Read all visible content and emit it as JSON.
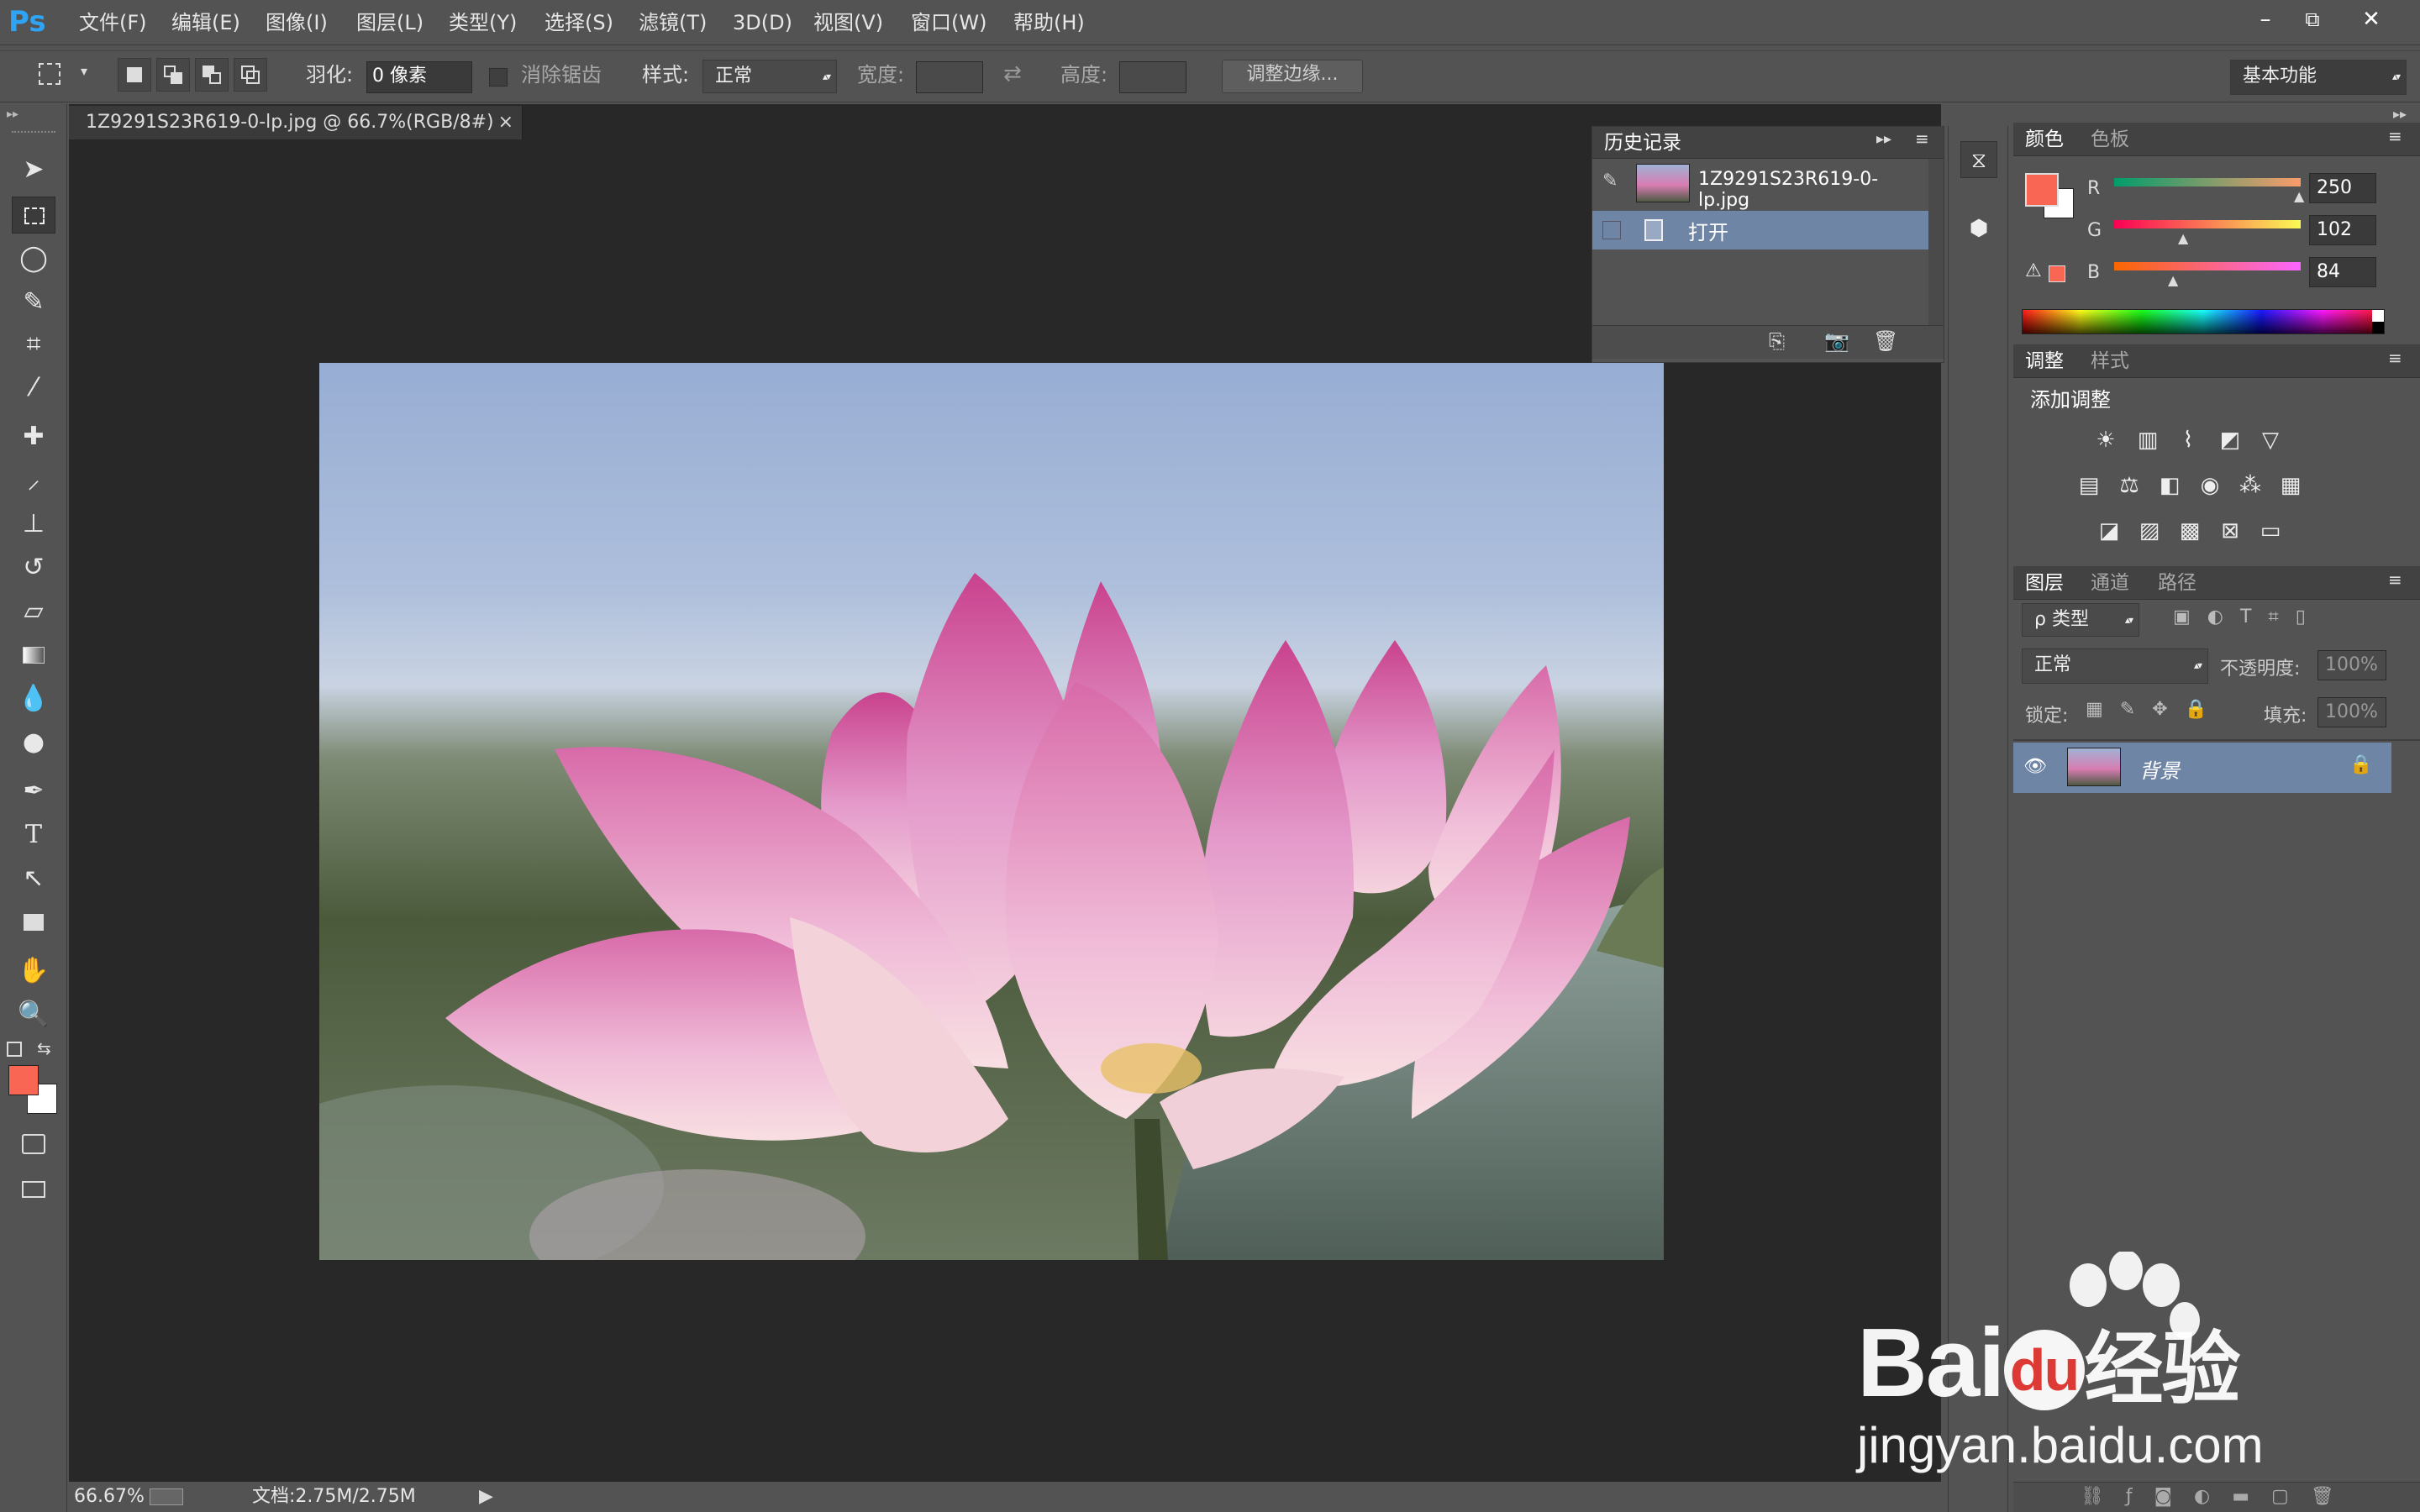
{
  "app": {
    "logo": "Ps"
  },
  "menu": {
    "items": [
      "文件(F)",
      "编辑(E)",
      "图像(I)",
      "图层(L)",
      "类型(Y)",
      "选择(S)",
      "滤镜(T)",
      "3D(D)",
      "视图(V)",
      "窗口(W)",
      "帮助(H)"
    ]
  },
  "window_controls": {
    "minimize": "–",
    "restore": "⧉",
    "close": "✕"
  },
  "options": {
    "feather_label": "羽化:",
    "feather_value": "0 像素",
    "antialias_label": "消除锯齿",
    "style_label": "样式:",
    "style_value": "正常",
    "width_label": "宽度:",
    "height_label": "高度:",
    "refine_edge": "调整边缘...",
    "workspace": "基本功能"
  },
  "document": {
    "tab_title": "1Z9291S23R619-0-lp.jpg @ 66.7%(RGB/8#)",
    "close": "×"
  },
  "status": {
    "zoom": "66.67%",
    "doc_size": "文档:2.75M/2.75M"
  },
  "history": {
    "tab": "历史记录",
    "snapshot_name": "1Z9291S23R619-0-lp.jpg",
    "steps": [
      "打开"
    ]
  },
  "color_panel": {
    "tabs": [
      "颜色",
      "色板"
    ],
    "r_label": "R",
    "g_label": "G",
    "b_label": "B",
    "r": "250",
    "g": "102",
    "b": "84",
    "foreground": "#FA6654",
    "background": "#FFFFFF"
  },
  "adjust_panel": {
    "tabs": [
      "调整",
      "样式"
    ],
    "heading": "添加调整"
  },
  "layers_panel": {
    "tabs": [
      "图层",
      "通道",
      "路径"
    ],
    "filter_kind": "ρ 类型",
    "blend_mode": "正常",
    "opacity_label": "不透明度:",
    "opacity_value": "100%",
    "lock_label": "锁定:",
    "fill_label": "填充:",
    "fill_value": "100%",
    "layer_name": "背景"
  },
  "watermark": {
    "brand_left": "Bai",
    "brand_mid": "du",
    "brand_right": "经验",
    "url": "jingyan.baidu.com"
  }
}
